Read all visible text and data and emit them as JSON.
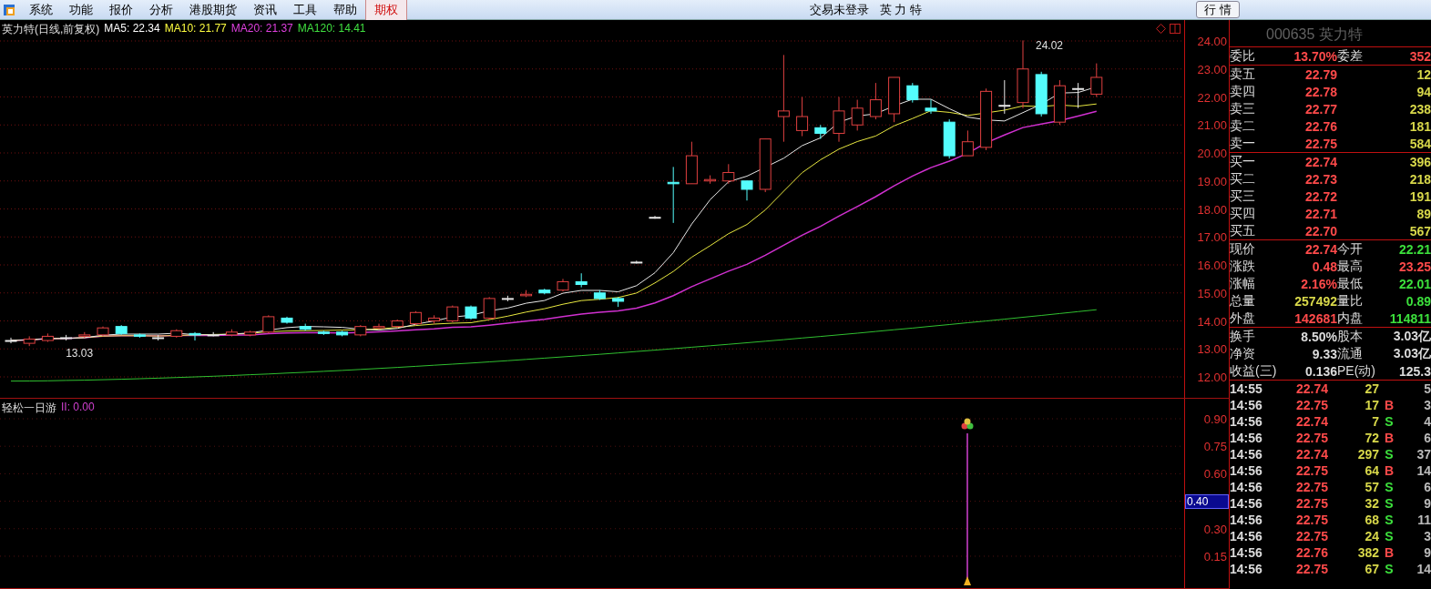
{
  "menu": {
    "items": [
      {
        "label": "系统",
        "selected": false
      },
      {
        "label": "功能",
        "selected": false
      },
      {
        "label": "报价",
        "selected": false
      },
      {
        "label": "分析",
        "selected": false
      },
      {
        "label": "港股期货",
        "selected": false
      },
      {
        "label": "资讯",
        "selected": false
      },
      {
        "label": "工具",
        "selected": false
      },
      {
        "label": "帮助",
        "selected": false
      },
      {
        "label": "期权",
        "selected": true
      }
    ],
    "status": "交易未登录",
    "stock": "英 力 特",
    "tab_button": "行 情"
  },
  "chart": {
    "title": "英力特(日线,前复权)",
    "ma": [
      {
        "label": "MA5: 22.34",
        "color": "#ffffff"
      },
      {
        "label": "MA10: 21.77",
        "color": "#ffff40"
      },
      {
        "label": "MA20: 21.37",
        "color": "#e040e0"
      },
      {
        "label": "MA120: 14.41",
        "color": "#40e040"
      }
    ],
    "high_label": "24.02",
    "low_label": "13.03",
    "price_ticks": [
      "24.00",
      "23.00",
      "22.00",
      "21.00",
      "20.00",
      "19.00",
      "18.00",
      "17.00",
      "16.00",
      "15.00",
      "14.00",
      "13.00",
      "12.00"
    ]
  },
  "indicator": {
    "name": "轻松一日游",
    "legend": "II: 0.00",
    "ticks": [
      "0.90",
      "0.75",
      "0.60",
      "0.30",
      "0.15"
    ],
    "current": "0.40"
  },
  "quote": {
    "header": "000635 英力特",
    "ratio": {
      "label": "委比",
      "value": "13.70%",
      "label2": "委差",
      "value2": "352"
    },
    "asks": [
      {
        "label": "卖五",
        "price": "22.79",
        "volume": "12"
      },
      {
        "label": "卖四",
        "price": "22.78",
        "volume": "94"
      },
      {
        "label": "卖三",
        "price": "22.77",
        "volume": "238"
      },
      {
        "label": "卖二",
        "price": "22.76",
        "volume": "181"
      },
      {
        "label": "卖一",
        "price": "22.75",
        "volume": "584"
      }
    ],
    "bids": [
      {
        "label": "买一",
        "price": "22.74",
        "volume": "396"
      },
      {
        "label": "买二",
        "price": "22.73",
        "volume": "218"
      },
      {
        "label": "买三",
        "price": "22.72",
        "volume": "191"
      },
      {
        "label": "买四",
        "price": "22.71",
        "volume": "89"
      },
      {
        "label": "买五",
        "price": "22.70",
        "volume": "567"
      }
    ],
    "stats": [
      {
        "label": "现价",
        "value": "22.74",
        "color": "#ff4a4a"
      },
      {
        "label": "今开",
        "value": "22.21",
        "color": "#3ce03c"
      },
      {
        "label": "涨跌",
        "value": "0.48",
        "color": "#ff4a4a"
      },
      {
        "label": "最高",
        "value": "23.25",
        "color": "#ff4a4a"
      },
      {
        "label": "涨幅",
        "value": "2.16%",
        "color": "#ff4a4a"
      },
      {
        "label": "最低",
        "value": "22.01",
        "color": "#3ce03c"
      },
      {
        "label": "总量",
        "value": "257492",
        "color": "#d8d84a"
      },
      {
        "label": "量比",
        "value": "0.89",
        "color": "#3ce03c"
      },
      {
        "label": "外盘",
        "value": "142681",
        "color": "#ff4a4a"
      },
      {
        "label": "内盘",
        "value": "114811",
        "color": "#3ce03c"
      }
    ],
    "finance": [
      {
        "label": "换手",
        "value": "8.50%",
        "label2": "股本",
        "value2": "3.03亿"
      },
      {
        "label": "净资",
        "value": "9.33",
        "label2": "流通",
        "value2": "3.03亿"
      },
      {
        "label": "收益(三)",
        "value": "0.136",
        "label2": "PE(动)",
        "value2": "125.3"
      }
    ],
    "ticks": [
      {
        "time": "14:55",
        "price": "22.74",
        "volume": "27",
        "column_5": "5"
      },
      {
        "time": "14:56",
        "price": "22.75",
        "volume": "17",
        "side": "B",
        "column_5": "3"
      },
      {
        "time": "14:56",
        "price": "22.74",
        "volume": "7",
        "side": "S",
        "column_5": "4"
      },
      {
        "time": "14:56",
        "price": "22.75",
        "volume": "72",
        "side": "B",
        "column_5": "6"
      },
      {
        "time": "14:56",
        "price": "22.74",
        "volume": "297",
        "side": "S",
        "column_5": "37"
      },
      {
        "time": "14:56",
        "price": "22.75",
        "volume": "64",
        "side": "B",
        "column_5": "14"
      },
      {
        "time": "14:56",
        "price": "22.75",
        "volume": "57",
        "side": "S",
        "column_5": "6"
      },
      {
        "time": "14:56",
        "price": "22.75",
        "volume": "32",
        "side": "S",
        "column_5": "9"
      },
      {
        "time": "14:56",
        "price": "22.75",
        "volume": "68",
        "side": "S",
        "column_5": "11"
      },
      {
        "time": "14:56",
        "price": "22.75",
        "volume": "24",
        "side": "S",
        "column_5": "3"
      },
      {
        "time": "14:56",
        "price": "22.76",
        "volume": "382",
        "side": "B",
        "column_5": "9"
      },
      {
        "time": "14:56",
        "price": "22.75",
        "volume": "67",
        "side": "S",
        "column_5": "14"
      }
    ]
  }
}
